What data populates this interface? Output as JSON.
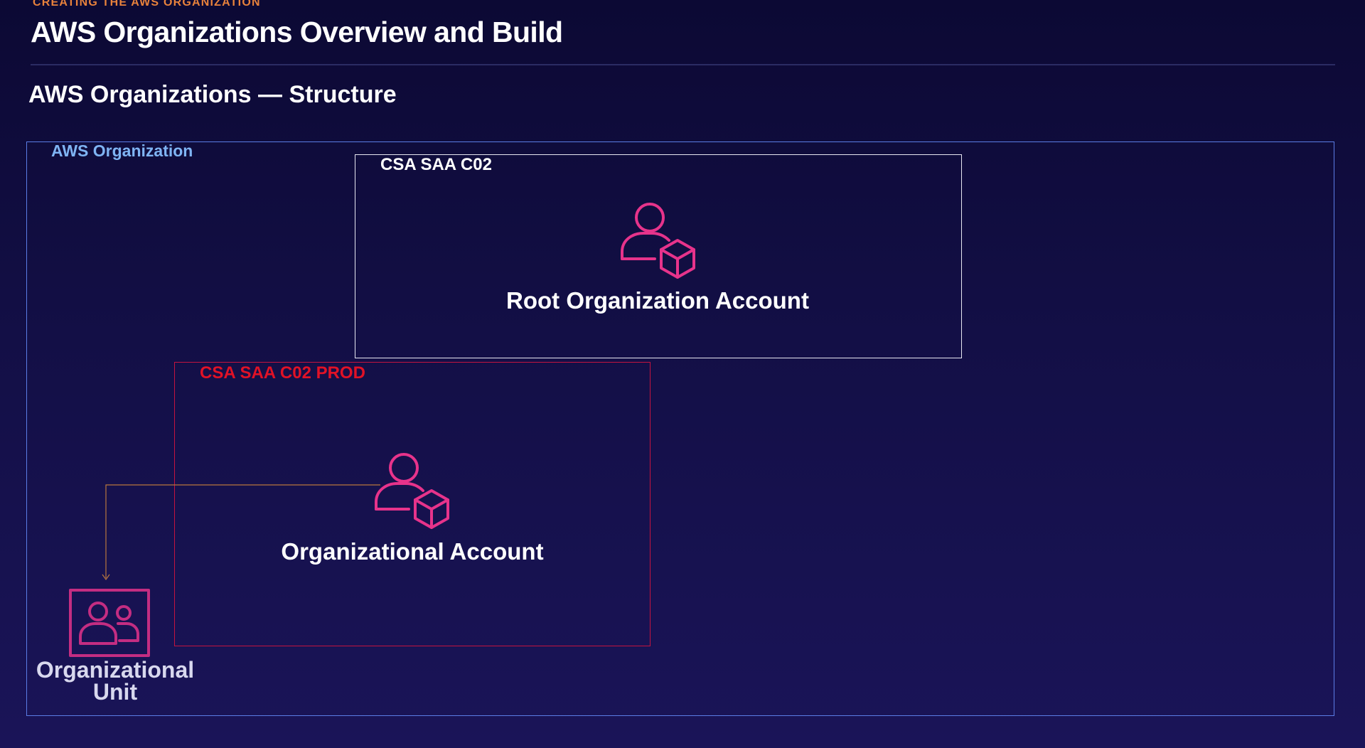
{
  "header": {
    "kicker": "CREATING THE AWS ORGANIZATION",
    "title": "AWS Organizations Overview and Build"
  },
  "diagram": {
    "section_title": "AWS Organizations — Structure",
    "organization_label": "AWS Organization",
    "root_container_label": "CSA SAA C02",
    "root_account": {
      "label": "Root Organization Account",
      "icon": "user-with-cube-icon"
    },
    "prod_container_label": "CSA SAA C02 PROD",
    "member_account": {
      "label": "Organizational Account",
      "icon": "user-with-cube-icon"
    },
    "organizational_unit": {
      "label_line1": "Organizational",
      "label_line2": "Unit",
      "icon": "group-users-icon"
    }
  },
  "colors": {
    "background": "#130f46",
    "kicker": "#e8823c",
    "organization_border": "#5b7de6",
    "organization_label": "#7fb4f3",
    "prod_border": "#c4133f",
    "prod_label": "#e11226",
    "icon_accent": "#e7338b",
    "ou_icon": "#c42d82"
  }
}
